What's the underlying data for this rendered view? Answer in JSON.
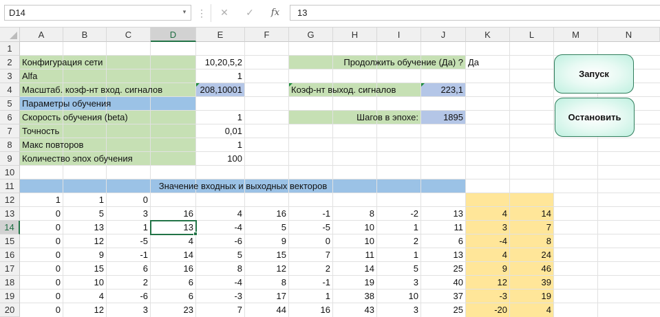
{
  "formula_bar": {
    "name_box": "D14",
    "name_box_arrow": "▾",
    "dots": "⋮",
    "cancel": "✕",
    "enter": "✓",
    "fx": "fx",
    "value": "13"
  },
  "columns": [
    "A",
    "B",
    "C",
    "D",
    "E",
    "F",
    "G",
    "H",
    "I",
    "J",
    "K",
    "L",
    "M",
    "N"
  ],
  "rows": [
    "1",
    "2",
    "3",
    "4",
    "5",
    "6",
    "7",
    "8",
    "9",
    "10",
    "11",
    "12",
    "13",
    "14",
    "15",
    "16",
    "17",
    "18",
    "19",
    "20"
  ],
  "colors": {
    "green_fill": "#c6e0b4",
    "blue_fill": "#9bc2e6",
    "light_blue_fill": "#b4c6e7",
    "yellow_fill": "#ffe699",
    "selection": "#217346"
  },
  "settings": {
    "config_label": "Конфигурация сети",
    "config_value": "10,20,5,2",
    "alfa_label": "Alfa",
    "alfa_value": "1",
    "input_scale_label": "Масштаб. коэф-нт вход. сигналов",
    "input_scale_value": "208,10001",
    "params_header": "Параметры обучения",
    "beta_label": "Скорость обучения (beta)",
    "beta_value": "1",
    "accuracy_label": "Точность",
    "accuracy_value": "0,01",
    "max_repeats_label": "Макс повторов",
    "max_repeats_value": "1",
    "epochs_label": "Количество эпох обучения",
    "epochs_value": "100",
    "continue_label": "Продолжить обучение (Да) ?",
    "continue_value": "Да",
    "output_scale_label": "Коэф-нт выход. сигналов",
    "output_scale_value": "223,1",
    "steps_label": "Шагов в  эпохе:",
    "steps_value": "1895",
    "vectors_header": "Значение входных и выходных векторов"
  },
  "buttons": {
    "start": "Запуск",
    "stop": "Остановить"
  },
  "table": {
    "row12": [
      "1",
      "1",
      "0"
    ],
    "rows": [
      [
        "0",
        "5",
        "3",
        "16",
        "4",
        "16",
        "-1",
        "8",
        "-2",
        "13",
        "4",
        "14"
      ],
      [
        "0",
        "13",
        "1",
        "13",
        "-4",
        "5",
        "-5",
        "10",
        "1",
        "11",
        "3",
        "7"
      ],
      [
        "0",
        "12",
        "-5",
        "4",
        "-6",
        "9",
        "0",
        "10",
        "2",
        "6",
        "-4",
        "8"
      ],
      [
        "0",
        "9",
        "-1",
        "14",
        "5",
        "15",
        "7",
        "11",
        "1",
        "13",
        "4",
        "24"
      ],
      [
        "0",
        "15",
        "6",
        "16",
        "8",
        "12",
        "2",
        "14",
        "5",
        "25",
        "9",
        "46"
      ],
      [
        "0",
        "10",
        "2",
        "6",
        "-4",
        "8",
        "-1",
        "19",
        "3",
        "40",
        "12",
        "39"
      ],
      [
        "0",
        "4",
        "-6",
        "6",
        "-3",
        "17",
        "1",
        "38",
        "10",
        "37",
        "-3",
        "19"
      ],
      [
        "0",
        "12",
        "3",
        "23",
        "7",
        "44",
        "16",
        "43",
        "3",
        "25",
        "-20",
        "4"
      ]
    ]
  }
}
